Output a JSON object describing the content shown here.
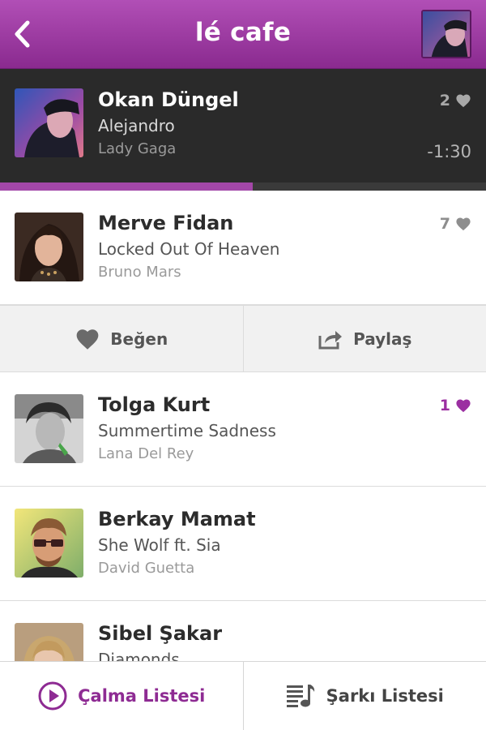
{
  "header": {
    "title": "lé cafe",
    "back_icon": "chevron-left-icon",
    "avatar": "profile-avatar"
  },
  "now_playing": {
    "user": "Okan Düngel",
    "song": "Alejandro",
    "artist": "Lady Gaga",
    "likes": "2",
    "time_remaining": "-1:30",
    "progress": 0.52
  },
  "queue": [
    {
      "user": "Merve Fidan",
      "song": "Locked Out Of Heaven",
      "artist": "Bruno Mars",
      "likes": "7",
      "liked": false
    },
    {
      "user": "Tolga Kurt",
      "song": "Summertime Sadness",
      "artist": "Lana Del Rey",
      "likes": "1",
      "liked": true
    },
    {
      "user": "Berkay Mamat",
      "song": "She Wolf ft. Sia",
      "artist": "David Guetta",
      "likes": "",
      "liked": false
    },
    {
      "user": "Sibel Şakar",
      "song": "Diamonds",
      "artist": "",
      "likes": "",
      "liked": false
    }
  ],
  "actions": {
    "like_label": "Beğen",
    "share_label": "Paylaş"
  },
  "tabs": {
    "playlist_label": "Çalma Listesi",
    "songs_label": "Şarkı Listesi"
  },
  "colors": {
    "brand": "#9b2fa1",
    "header_top": "#b14fb6",
    "now_playing_bg": "#2a2a2a"
  }
}
